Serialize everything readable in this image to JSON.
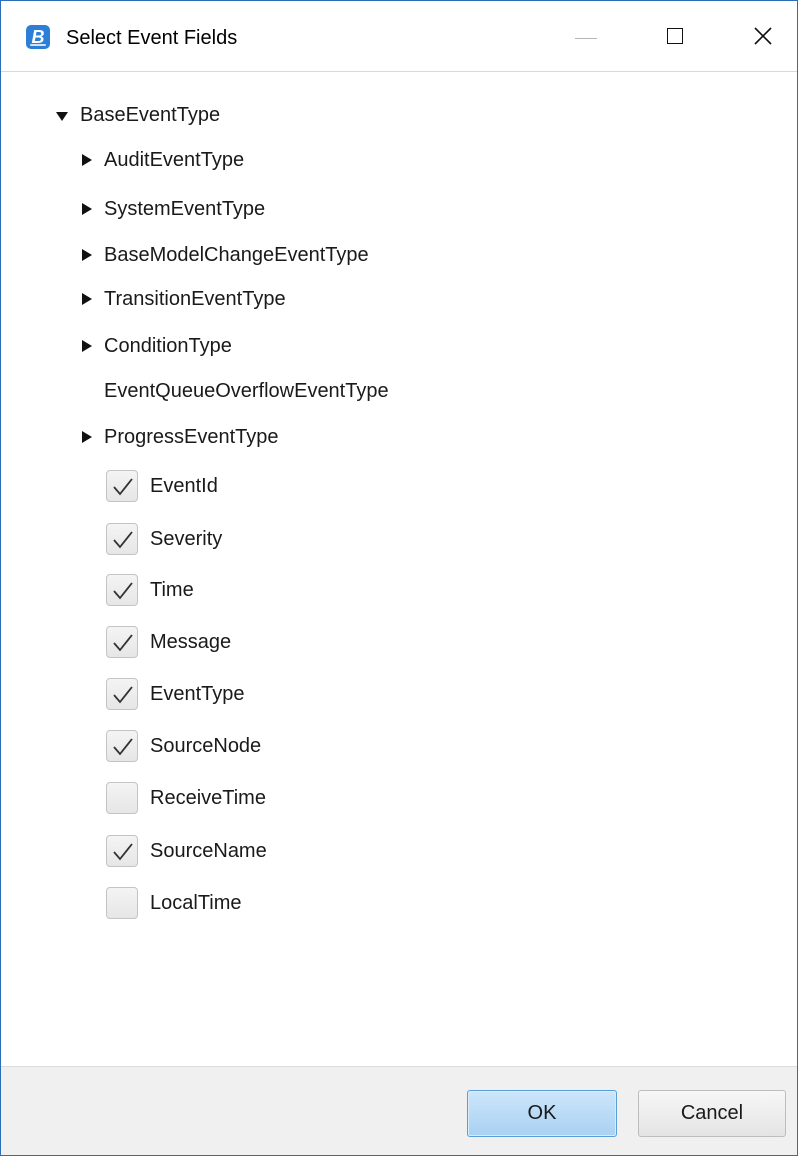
{
  "window": {
    "title": "Select Event Fields",
    "app_icon_letter": "B"
  },
  "tree": {
    "root": {
      "label": "BaseEventType",
      "expanded": true
    },
    "subtypes": [
      {
        "label": "AuditEventType",
        "expandable": true
      },
      {
        "label": "SystemEventType",
        "expandable": true
      },
      {
        "label": "BaseModelChangeEventType",
        "expandable": true
      },
      {
        "label": "TransitionEventType",
        "expandable": true
      },
      {
        "label": "ConditionType",
        "expandable": true
      },
      {
        "label": "EventQueueOverflowEventType",
        "expandable": false
      },
      {
        "label": "ProgressEventType",
        "expandable": true
      }
    ],
    "fields": [
      {
        "label": "EventId",
        "checked": true
      },
      {
        "label": "Severity",
        "checked": true
      },
      {
        "label": "Time",
        "checked": true
      },
      {
        "label": "Message",
        "checked": true
      },
      {
        "label": "EventType",
        "checked": true
      },
      {
        "label": "SourceNode",
        "checked": true
      },
      {
        "label": "ReceiveTime",
        "checked": false
      },
      {
        "label": "SourceName",
        "checked": true
      },
      {
        "label": "LocalTime",
        "checked": false
      }
    ]
  },
  "buttons": {
    "ok": "OK",
    "cancel": "Cancel"
  },
  "colors": {
    "accent": "#2b7fd6",
    "ok_button": "#a9d1f2",
    "footer": "#f0f0f0"
  }
}
